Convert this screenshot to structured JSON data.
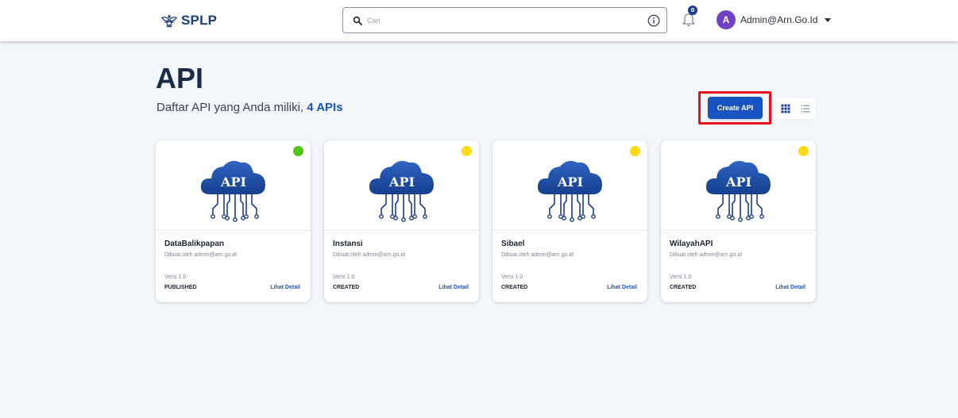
{
  "header": {
    "logo_text": "SPLP",
    "search_placeholder": "Cari",
    "notification_count": "0",
    "user_initial": "A",
    "user_name": "Admin@Arn.Go.Id"
  },
  "page": {
    "title": "API",
    "subtitle_prefix": "Daftar API yang Anda miliki,",
    "subtitle_count": "4 APIs",
    "create_button": "Create API",
    "art_label": "API"
  },
  "colors": {
    "accent": "#1754c1",
    "status_published": "#52c41a",
    "status_created": "#fadb14",
    "highlight": "#e8101c"
  },
  "cards": [
    {
      "title": "DataBalikpapan",
      "author": "Dibuat oleh admin@arn.go.id",
      "version": "Versi 1.0",
      "status": "PUBLISHED",
      "link": "Lihat Detail",
      "dot_color": "#52c41a"
    },
    {
      "title": "Instansi",
      "author": "Dibuat oleh admin@arn.go.id",
      "version": "Versi 1.0",
      "status": "CREATED",
      "link": "Lihat Detail",
      "dot_color": "#fadb14"
    },
    {
      "title": "Sibael",
      "author": "Dibuat oleh admin@arn.go.id",
      "version": "Versi 1.0",
      "status": "CREATED",
      "link": "Lihat Detail",
      "dot_color": "#fadb14"
    },
    {
      "title": "WilayahAPI",
      "author": "Dibuat oleh admin@arn.go.id",
      "version": "Versi 1.0",
      "status": "CREATED",
      "link": "Lihat Detail",
      "dot_color": "#fadb14"
    }
  ]
}
